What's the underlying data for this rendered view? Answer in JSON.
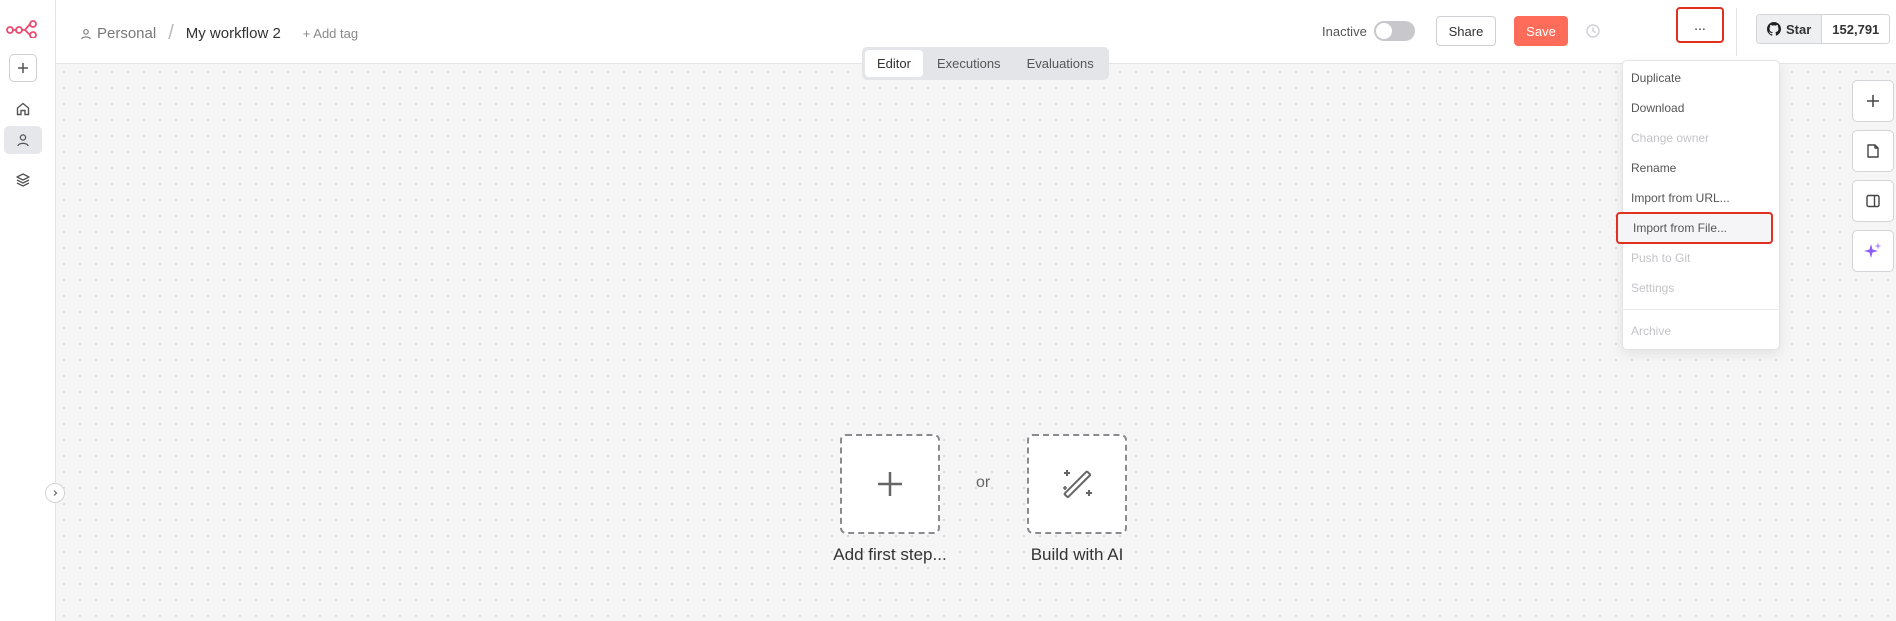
{
  "header": {
    "project": "Personal",
    "workflow_title": "My workflow 2",
    "add_tag": "+ Add tag",
    "status": "Inactive",
    "share_label": "Share",
    "save_label": "Save",
    "more_label": "...",
    "github_star": "Star",
    "github_count": "152,791"
  },
  "tabs": [
    "Editor",
    "Executions",
    "Evaluations"
  ],
  "canvas": {
    "add_first_step": "Add first step...",
    "or": "or",
    "build_with_ai": "Build with AI"
  },
  "menu": {
    "items": [
      {
        "label": "Duplicate",
        "disabled": false
      },
      {
        "label": "Download",
        "disabled": false
      },
      {
        "label": "Change owner",
        "disabled": true
      },
      {
        "label": "Rename",
        "disabled": false
      },
      {
        "label": "Import from URL...",
        "disabled": false
      },
      {
        "label": "Import from File...",
        "disabled": false,
        "highlighted": true
      },
      {
        "label": "Push to Git",
        "disabled": true
      },
      {
        "label": "Settings",
        "disabled": true
      },
      {
        "label": "Archive",
        "disabled": true
      }
    ]
  },
  "colors": {
    "brand": "#ea4b71",
    "save": "#ff6d5a",
    "highlight_border": "#e0301e",
    "ai_accent": "#8b5cf6"
  }
}
